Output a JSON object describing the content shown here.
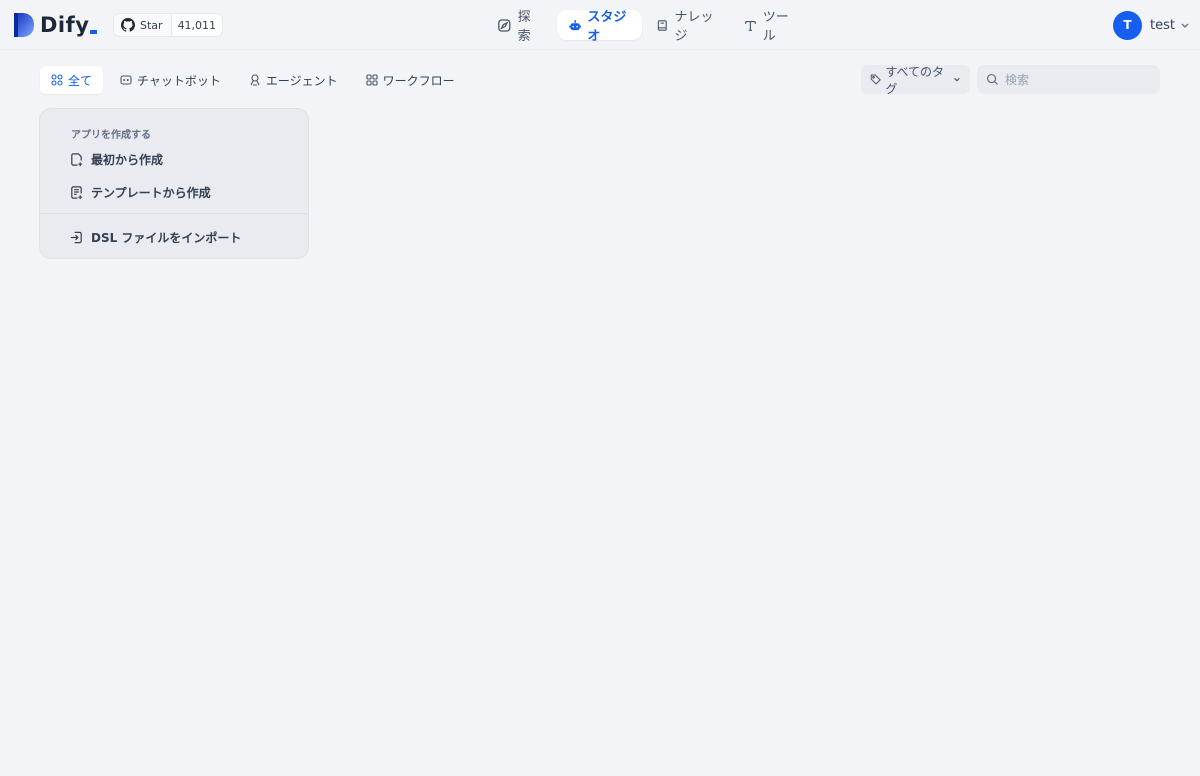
{
  "header": {
    "logo_text": "Dify",
    "github": {
      "star_label": "Star",
      "star_count": "41,011"
    },
    "nav": [
      {
        "label": "探索",
        "icon": "compass-icon",
        "active": false
      },
      {
        "label": "スタジオ",
        "icon": "robot-icon",
        "active": true
      },
      {
        "label": "ナレッジ",
        "icon": "book-icon",
        "active": false
      },
      {
        "label": "ツール",
        "icon": "tool-icon",
        "active": false
      }
    ],
    "user": {
      "avatar_initial": "T",
      "name": "test"
    }
  },
  "toolbar": {
    "tabs": [
      {
        "label": "全て",
        "icon": "grid-icon",
        "active": true
      },
      {
        "label": "チャットボット",
        "icon": "chat-icon",
        "active": false
      },
      {
        "label": "エージェント",
        "icon": "agent-icon",
        "active": false
      },
      {
        "label": "ワークフロー",
        "icon": "workflow-icon",
        "active": false
      }
    ],
    "tag_filter_label": "すべてのタグ",
    "search_placeholder": "検索"
  },
  "create_card": {
    "title": "アプリを作成する",
    "items": [
      {
        "label": "最初から作成",
        "icon": "new-file-icon"
      },
      {
        "label": "テンプレートから作成",
        "icon": "template-icon"
      },
      {
        "label": "DSL ファイルをインポート",
        "icon": "import-icon"
      }
    ]
  },
  "colors": {
    "accent": "#155eef",
    "background": "#f2f4f7",
    "card": "#e9ebf0"
  }
}
